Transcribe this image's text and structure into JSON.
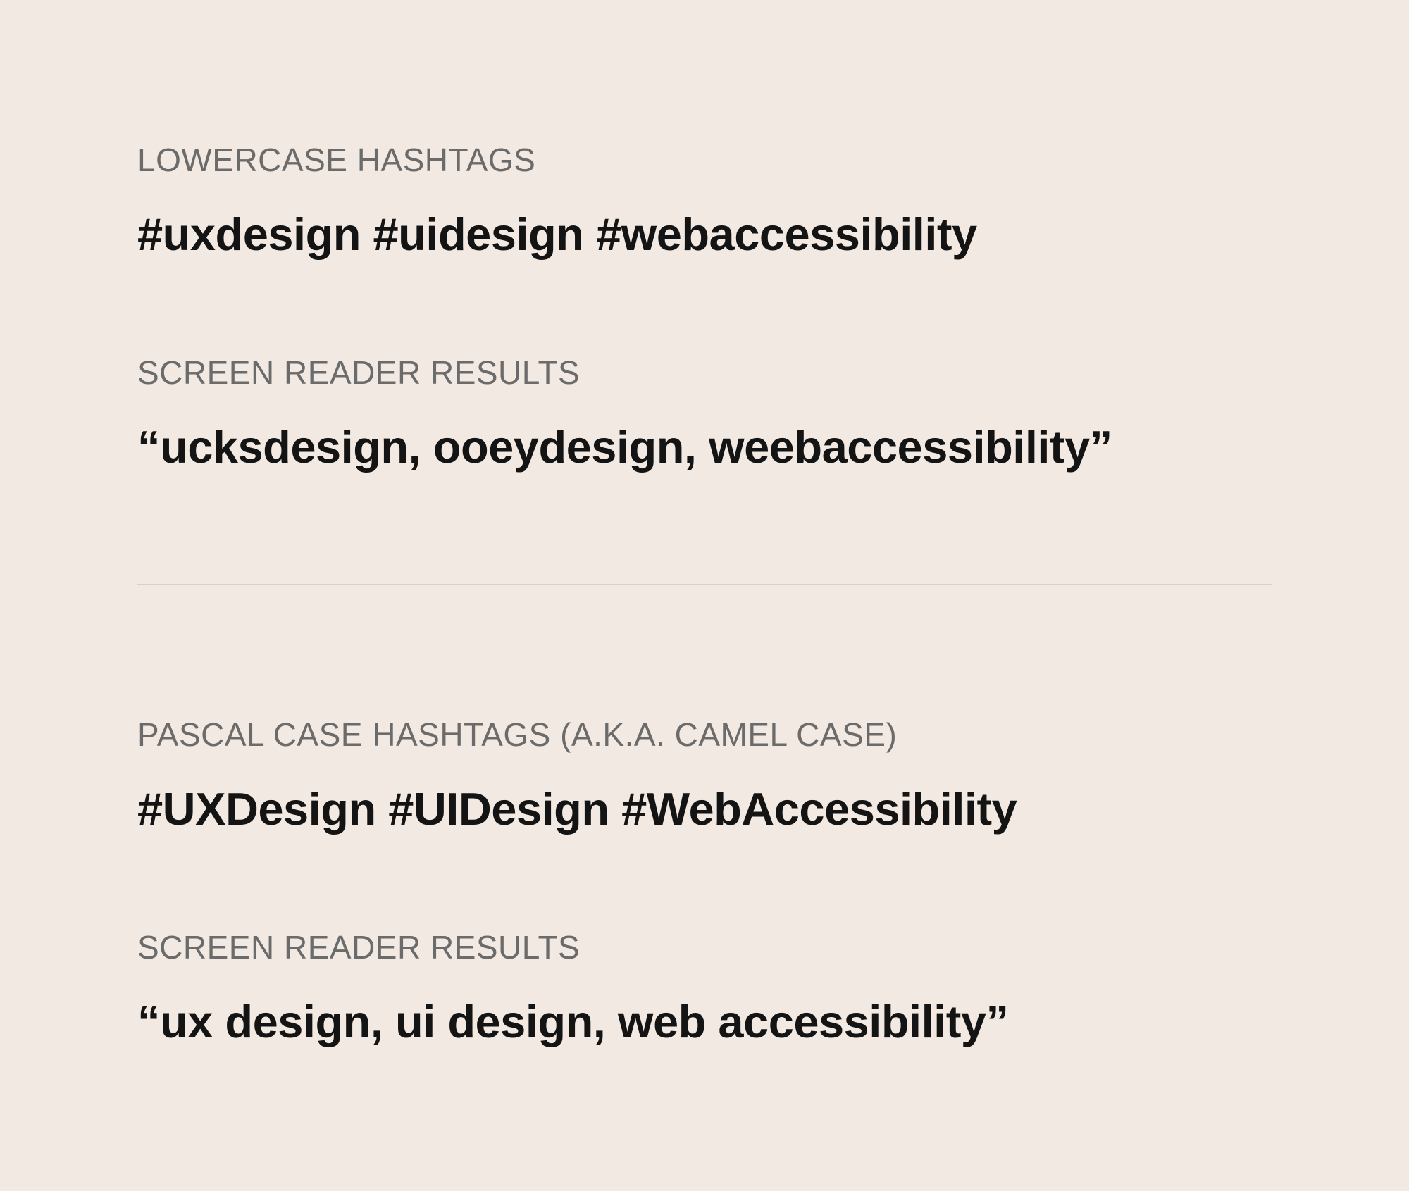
{
  "sections": {
    "top": {
      "hashtags_label": "LOWERCASE HASHTAGS",
      "hashtags_content": "#uxdesign #uidesign #webaccessibility",
      "results_label": "SCREEN READER RESULTS",
      "results_content": "“ucksdesign, ooeydesign, weebaccessibility”"
    },
    "bottom": {
      "hashtags_label": "PASCAL CASE HASHTAGS (A.K.A. CAMEL CASE)",
      "hashtags_content": "#UXDesign #UIDesign #WebAccessibility",
      "results_label": "SCREEN READER RESULTS",
      "results_content": "“ux design, ui design, web accessibility”"
    }
  }
}
